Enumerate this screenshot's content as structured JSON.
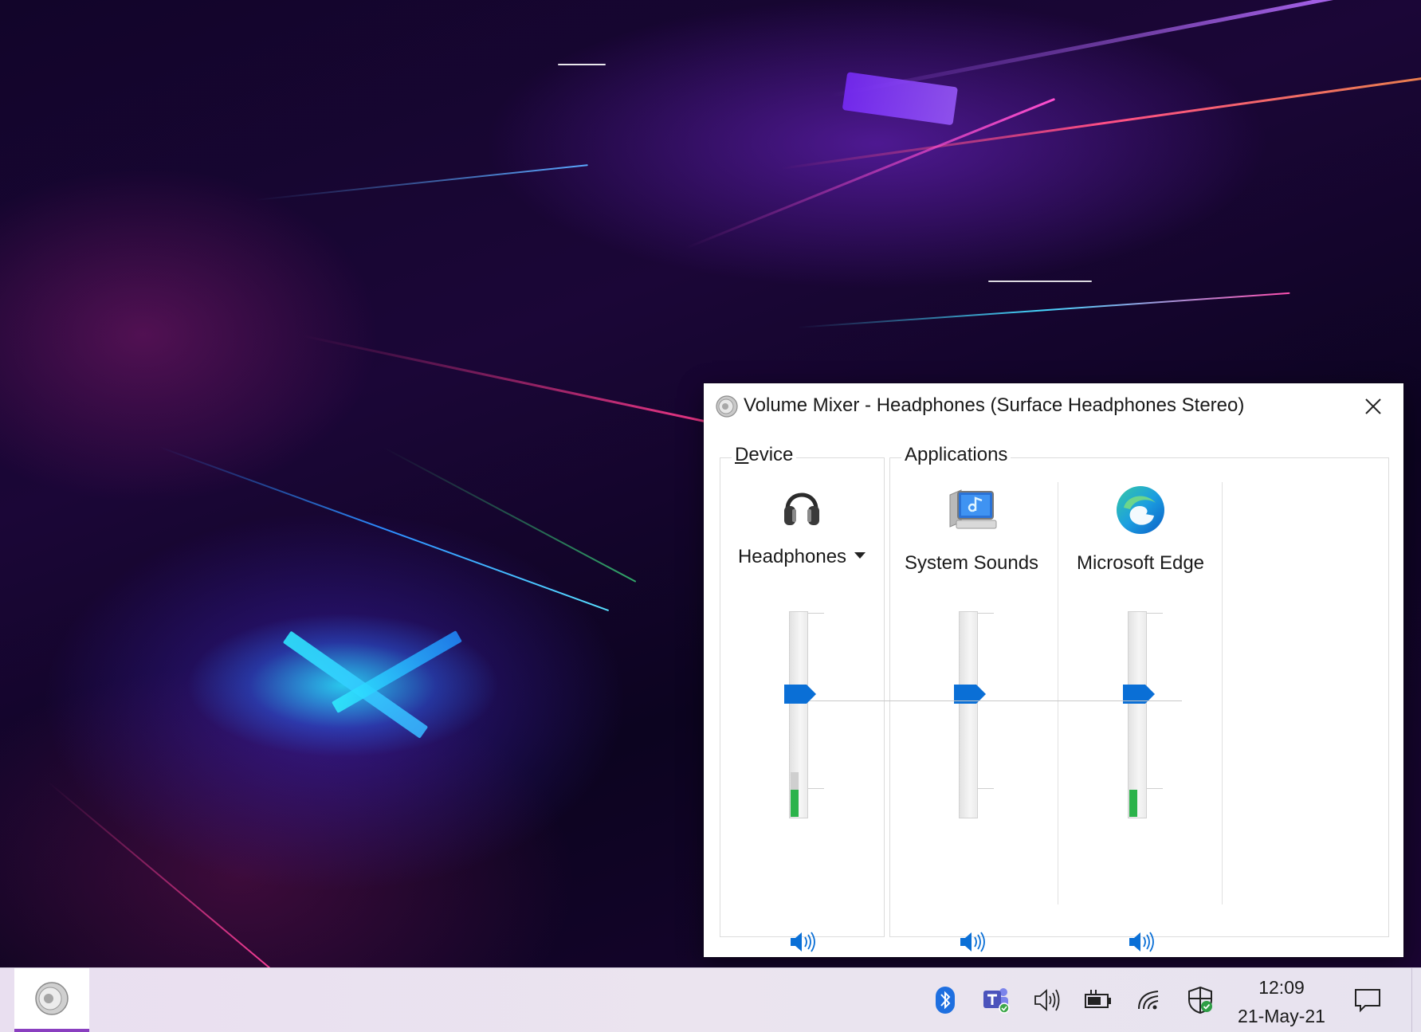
{
  "window": {
    "title": "Volume Mixer - Headphones (Surface Headphones Stereo)",
    "close_icon": "close-icon"
  },
  "device_group": {
    "label_first": "D",
    "label_rest": "evice",
    "device": {
      "name": "Headphones",
      "icon": "headphones-icon",
      "volume_level": 0.6,
      "peak_level": 0.12,
      "peak_hold_level": 0.2,
      "mute_icon": "speaker-icon"
    }
  },
  "applications_group": {
    "label": "Applications",
    "apps": [
      {
        "name": "System Sounds",
        "icon": "system-sounds-icon",
        "volume_level": 0.6,
        "peak_level": 0.0,
        "mute_icon": "speaker-icon"
      },
      {
        "name": "Microsoft Edge",
        "icon": "edge-icon",
        "volume_level": 0.6,
        "peak_level": 0.12,
        "mute_icon": "speaker-icon"
      }
    ]
  },
  "taskbar": {
    "active_app_icon": "volume-mixer-icon",
    "tray_icons": [
      "bluetooth-icon",
      "teams-icon",
      "volume-icon",
      "battery-icon",
      "wifi-icon",
      "security-icon"
    ],
    "time": "12:09",
    "date": "21-May-21",
    "notification_icon": "action-center-icon"
  },
  "colors": {
    "accent": "#0a6fd6",
    "peak_meter": "#2bb34a"
  }
}
